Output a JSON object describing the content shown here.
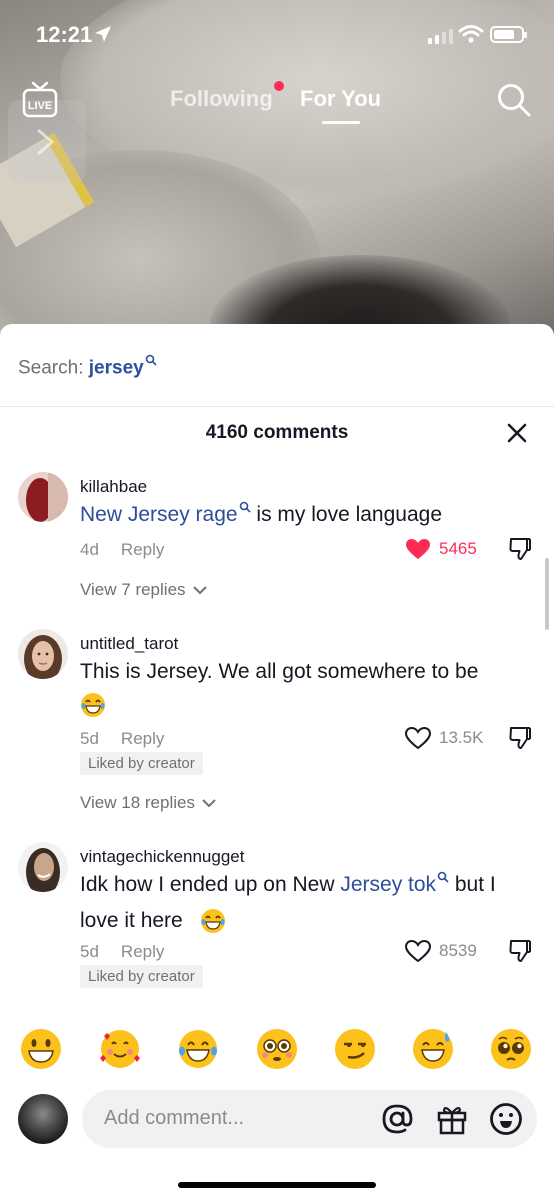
{
  "status_bar": {
    "time": "12:21"
  },
  "top_nav": {
    "live_label": "LIVE",
    "tabs": [
      {
        "label": "Following",
        "selected": false,
        "has_dot": true
      },
      {
        "label": "For You",
        "selected": true
      }
    ]
  },
  "sheet": {
    "search_prefix": "Search: ",
    "search_term": "jersey",
    "comment_count": "4160 comments",
    "comments": [
      {
        "username": "killahbae",
        "text_highlight": "New Jersey rage",
        "text_rest": " is my love language",
        "age": "4d",
        "reply_label": "Reply",
        "likes": "5465",
        "liked": true,
        "view_replies": "View 7 replies"
      },
      {
        "username": "untitled_tarot",
        "text": "This is Jersey. We all got somewhere to be",
        "emoji": "laughing",
        "age": "5d",
        "reply_label": "Reply",
        "likes": "13.5K",
        "liked": false,
        "badge": "Liked by creator",
        "view_replies": "View 18 replies"
      },
      {
        "username": "vintagechickennugget",
        "text_before": "Idk how I ended up on New ",
        "text_highlight": "Jersey tok",
        "text_after": " but I",
        "text_line2": "love it here",
        "emoji": "laughing",
        "age": "5d",
        "reply_label": "Reply",
        "likes": "8539",
        "liked": false,
        "badge": "Liked by creator"
      }
    ]
  },
  "emoji_bar": [
    "grinning",
    "smiling-hearts",
    "laughing",
    "flushed",
    "smirking",
    "sweat-smile",
    "pleading"
  ],
  "composer": {
    "placeholder": "Add comment..."
  },
  "colors": {
    "accent_red": "#fe2c55",
    "link_blue": "#2d4e9a",
    "text": "#161823",
    "muted": "#8a8b91"
  }
}
